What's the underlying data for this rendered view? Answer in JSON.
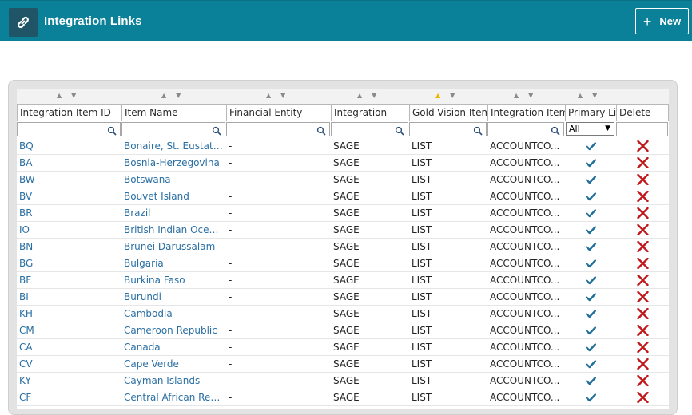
{
  "header": {
    "title": "Integration Links",
    "new_label": "New",
    "bar_color": "#0a8099"
  },
  "grid": {
    "columns": [
      {
        "label": "Integration Item ID",
        "sort": "none"
      },
      {
        "label": "Item Name",
        "sort": "none"
      },
      {
        "label": "Financial Entity",
        "sort": "none"
      },
      {
        "label": "Integration",
        "sort": "none"
      },
      {
        "label": "Gold-Vision Item",
        "sort": "ascending"
      },
      {
        "label": "Integration Item",
        "sort": "none"
      },
      {
        "label": "Primary Lin",
        "sort": "none"
      },
      {
        "label": "Delete",
        "sort": "none"
      }
    ],
    "primary_filter_value": "All",
    "rows": [
      {
        "id": "BQ",
        "name": "Bonaire, St. Eustati...",
        "entity": "-",
        "integration": "SAGE",
        "gv_item": "LIST",
        "int_item": "ACCOUNTCO...",
        "primary": true
      },
      {
        "id": "BA",
        "name": "Bosnia-Herzegovina",
        "entity": "-",
        "integration": "SAGE",
        "gv_item": "LIST",
        "int_item": "ACCOUNTCO...",
        "primary": true
      },
      {
        "id": "BW",
        "name": "Botswana",
        "entity": "-",
        "integration": "SAGE",
        "gv_item": "LIST",
        "int_item": "ACCOUNTCO...",
        "primary": true
      },
      {
        "id": "BV",
        "name": "Bouvet Island",
        "entity": "-",
        "integration": "SAGE",
        "gv_item": "LIST",
        "int_item": "ACCOUNTCO...",
        "primary": true
      },
      {
        "id": "BR",
        "name": "Brazil",
        "entity": "-",
        "integration": "SAGE",
        "gv_item": "LIST",
        "int_item": "ACCOUNTCO...",
        "primary": true
      },
      {
        "id": "IO",
        "name": "British Indian Ocea...",
        "entity": "-",
        "integration": "SAGE",
        "gv_item": "LIST",
        "int_item": "ACCOUNTCO...",
        "primary": true
      },
      {
        "id": "BN",
        "name": "Brunei Darussalam",
        "entity": "-",
        "integration": "SAGE",
        "gv_item": "LIST",
        "int_item": "ACCOUNTCO...",
        "primary": true
      },
      {
        "id": "BG",
        "name": "Bulgaria",
        "entity": "-",
        "integration": "SAGE",
        "gv_item": "LIST",
        "int_item": "ACCOUNTCO...",
        "primary": true
      },
      {
        "id": "BF",
        "name": "Burkina Faso",
        "entity": "-",
        "integration": "SAGE",
        "gv_item": "LIST",
        "int_item": "ACCOUNTCO...",
        "primary": true
      },
      {
        "id": "BI",
        "name": "Burundi",
        "entity": "-",
        "integration": "SAGE",
        "gv_item": "LIST",
        "int_item": "ACCOUNTCO...",
        "primary": true
      },
      {
        "id": "KH",
        "name": "Cambodia",
        "entity": "-",
        "integration": "SAGE",
        "gv_item": "LIST",
        "int_item": "ACCOUNTCO...",
        "primary": true
      },
      {
        "id": "CM",
        "name": "Cameroon Republic",
        "entity": "-",
        "integration": "SAGE",
        "gv_item": "LIST",
        "int_item": "ACCOUNTCO...",
        "primary": true
      },
      {
        "id": "CA",
        "name": "Canada",
        "entity": "-",
        "integration": "SAGE",
        "gv_item": "LIST",
        "int_item": "ACCOUNTCO...",
        "primary": true
      },
      {
        "id": "CV",
        "name": "Cape Verde",
        "entity": "-",
        "integration": "SAGE",
        "gv_item": "LIST",
        "int_item": "ACCOUNTCO...",
        "primary": true
      },
      {
        "id": "KY",
        "name": "Cayman Islands",
        "entity": "-",
        "integration": "SAGE",
        "gv_item": "LIST",
        "int_item": "ACCOUNTCO...",
        "primary": true
      },
      {
        "id": "CF",
        "name": "Central African Rep...",
        "entity": "-",
        "integration": "SAGE",
        "gv_item": "LIST",
        "int_item": "ACCOUNTCO...",
        "primary": true
      }
    ]
  },
  "icons": {
    "app": "link-icon",
    "new": "plus-icon",
    "filter": "search-icon",
    "primary": "check-icon",
    "delete": "delete-x-icon"
  },
  "colors": {
    "link_text": "#2a6fa3",
    "check": "#1f6f9a",
    "delete": "#c0171b",
    "sort_active": "#f0b400"
  }
}
